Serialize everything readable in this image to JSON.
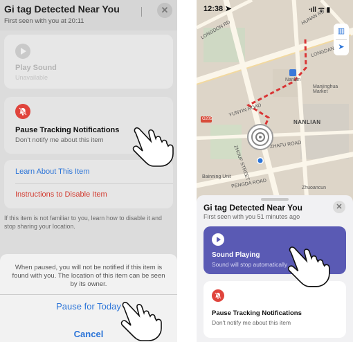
{
  "left": {
    "title": "Gi tag Detected Near You",
    "subtitle": "First seen with you at 20:11",
    "close_glyph": "✕",
    "play_sound": {
      "label": "Play Sound",
      "status": "Unavailable",
      "icon": "play-icon"
    },
    "pause_tracking": {
      "title": "Pause Tracking Notifications",
      "subtitle": "Don't notify me about this item",
      "icon": "bell-slash-icon"
    },
    "learn_link": "Learn About This Item",
    "instructions_link": "Instructions to Disable Item",
    "info_text": "If this item is not familiar to you, learn how to disable it and stop sharing your location.",
    "sheet": {
      "message": "When paused, you will not be notified if this item is found with you. The location of this item can be seen by its owner.",
      "pause_today": "Pause for Today",
      "cancel": "Cancel"
    }
  },
  "right": {
    "status_bar": {
      "time": "12:38 ➤",
      "indicators": "ᐧıll ᯤ ▮"
    },
    "map": {
      "labels": {
        "road_top_left": "LONGDON RD",
        "road_top_right": "HUNAN RD",
        "road_right": "LONGDAN",
        "metro": "Nanlan",
        "district": "Manjinghua Market",
        "road_mid": "YUNYIN ROAD",
        "area": "NANLIAN",
        "road_east": "ZHAFU ROAD",
        "road_sw": "ZHOUF STREET",
        "road_bottom": "PENGDA ROAD",
        "shop_left": "Bainning Unit",
        "shop_right": "Zhuoancun",
        "badge": "G205"
      },
      "controls": {
        "map_icon": "map-icon",
        "location_icon": "location-arrow-icon"
      }
    },
    "sheet": {
      "title": "Gi tag Detected Near You",
      "subtitle": "First seen with you 51 minutes ago",
      "close_glyph": "✕",
      "sound_card": {
        "label": "Sound Playing",
        "status": "Sound will stop automatically",
        "icon": "play-icon"
      },
      "pause_tracking": {
        "title": "Pause Tracking Notifications",
        "subtitle": "Don't notify me about this item",
        "icon": "bell-slash-icon"
      }
    }
  },
  "colors": {
    "accent_blue": "#2b74d8",
    "danger_red": "#d23b30",
    "bell_red": "#e0443c",
    "sound_card_purple": "#5a5ab4",
    "route_red": "#d93434"
  }
}
